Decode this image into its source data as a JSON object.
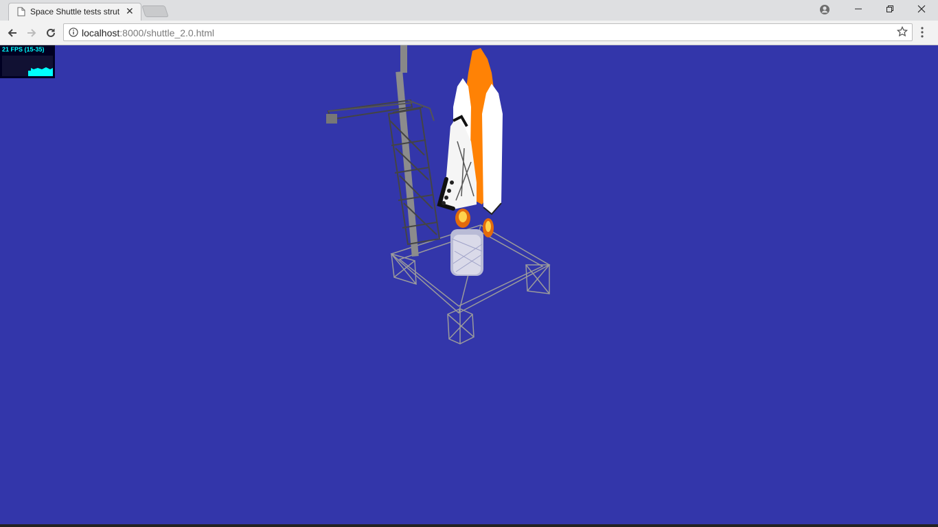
{
  "browser": {
    "tab_title": "Space Shuttle tests strut",
    "url_host": "localhost",
    "url_rest": ":8000/shuttle_2.0.html"
  },
  "stats": {
    "fps_label": "21 FPS (15-35)",
    "fps_color": "#00ffff"
  },
  "scene": {
    "background": "#3336aa",
    "objects": [
      "launch-tower",
      "space-shuttle",
      "external-tank",
      "solid-rocket-boosters",
      "exhaust-plume",
      "launch-platform"
    ]
  },
  "icons": {
    "tab": "document-icon",
    "close": "close-icon",
    "back": "back-arrow-icon",
    "forward": "forward-arrow-icon",
    "reload": "reload-icon",
    "info": "info-icon",
    "star": "star-icon",
    "menu": "kebab-menu-icon",
    "profile": "profile-icon"
  }
}
